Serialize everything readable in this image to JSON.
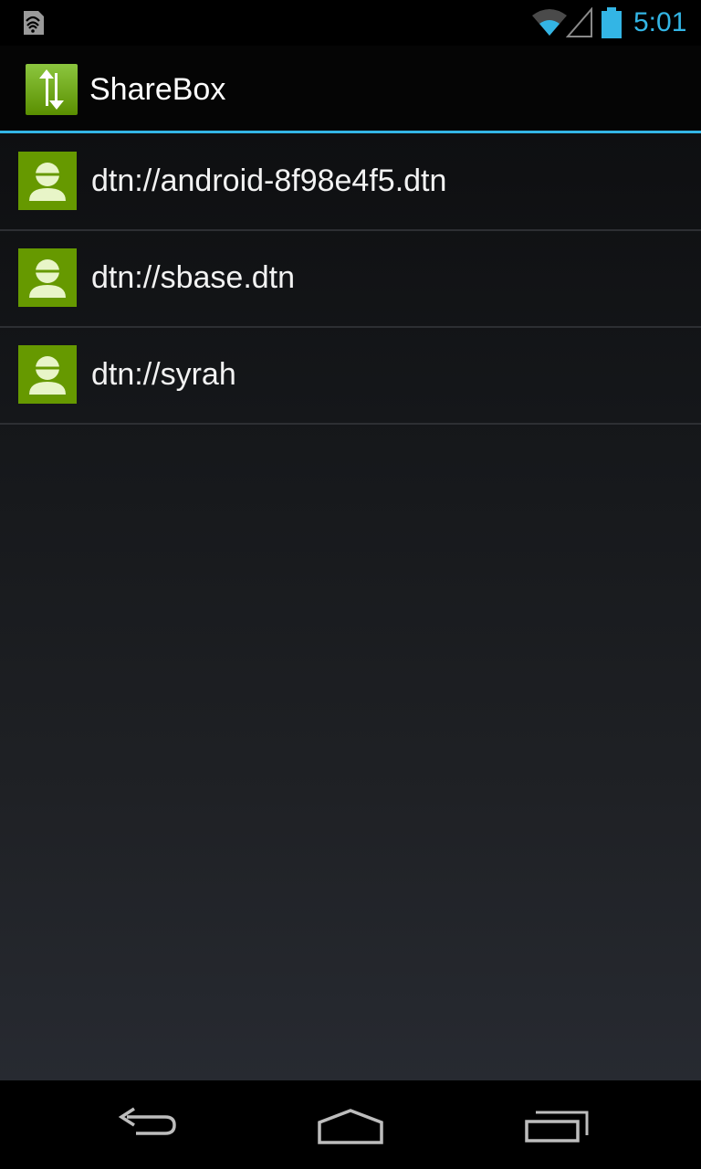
{
  "status_bar": {
    "time": "5:01",
    "accent_color": "#33b5e5",
    "icons": [
      "notification-icon",
      "wifi-icon",
      "cell-signal-icon",
      "battery-icon"
    ]
  },
  "action_bar": {
    "title": "ShareBox",
    "app_icon": "sharebox-app-icon",
    "brand_color": "#669900"
  },
  "devices": [
    {
      "label": "dtn://android-8f98e4f5.dtn",
      "icon": "user-avatar-icon"
    },
    {
      "label": "dtn://sbase.dtn",
      "icon": "user-avatar-icon"
    },
    {
      "label": "dtn://syrah",
      "icon": "user-avatar-icon"
    }
  ],
  "nav_bar": {
    "buttons": [
      "back-icon",
      "home-icon",
      "recent-apps-icon"
    ]
  }
}
